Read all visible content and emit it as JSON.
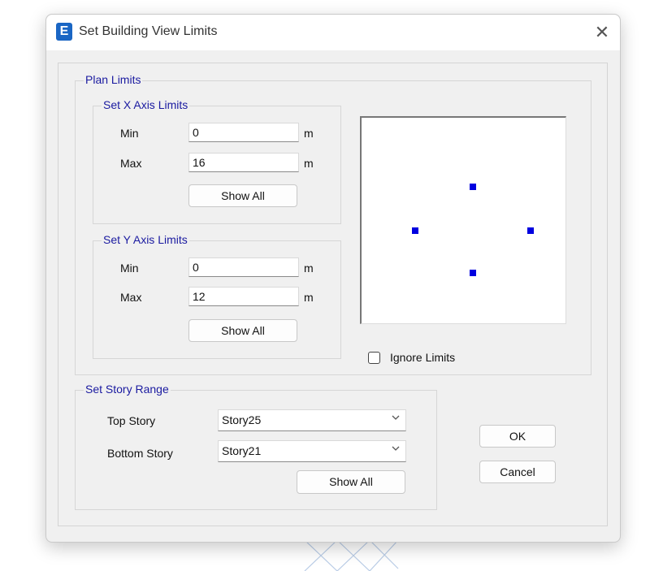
{
  "window": {
    "title": "Set Building View Limits",
    "app_icon_letter": "E",
    "close_glyph": "✕"
  },
  "plan_limits": {
    "title": "Plan Limits",
    "x_axis": {
      "title": "Set X Axis Limits",
      "min_label": "Min",
      "min_value": "0",
      "max_label": "Max",
      "max_value": "16",
      "unit": "m",
      "show_all": "Show All"
    },
    "y_axis": {
      "title": "Set Y Axis Limits",
      "min_label": "Min",
      "min_value": "0",
      "max_label": "Max",
      "max_value": "12",
      "unit": "m",
      "show_all": "Show All"
    },
    "preview_marker_color": "#0000e0",
    "ignore_limits": {
      "label": "Ignore Limits",
      "checked": false
    }
  },
  "story_range": {
    "title": "Set Story Range",
    "top_label": "Top Story",
    "top_value": "Story25",
    "bottom_label": "Bottom Story",
    "bottom_value": "Story21",
    "show_all": "Show All"
  },
  "buttons": {
    "ok": "OK",
    "cancel": "Cancel"
  },
  "icons": {
    "dropdown": "chevron-down-icon",
    "close": "close-icon",
    "app": "etabs-app-icon"
  }
}
